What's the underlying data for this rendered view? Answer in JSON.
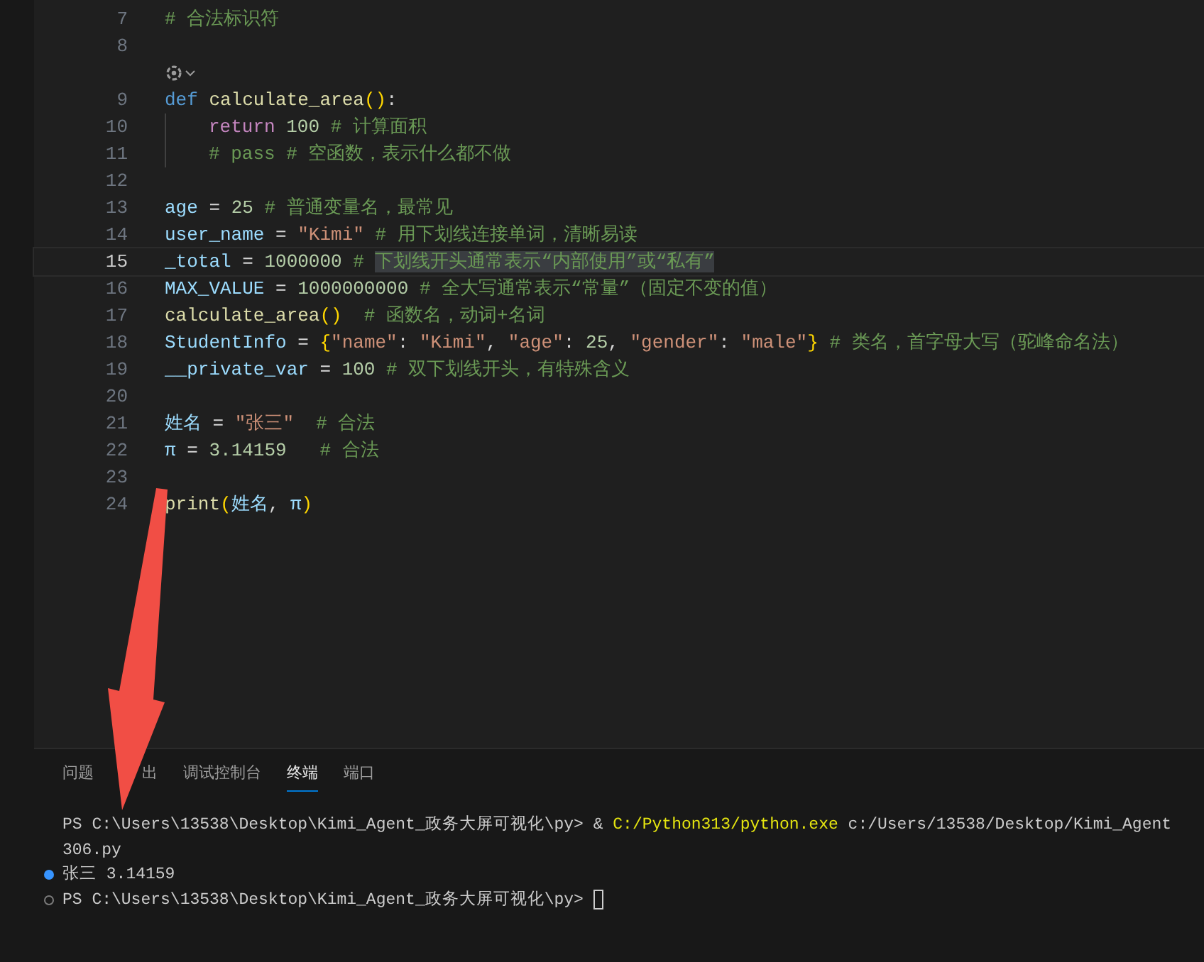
{
  "editor": {
    "lines": [
      {
        "kind": "code",
        "number": "7",
        "current": false,
        "tokens": [
          {
            "kind": "comment",
            "text": "# 合法标识符"
          }
        ]
      },
      {
        "kind": "code",
        "number": "8",
        "current": false
      },
      {
        "kind": "codelens"
      },
      {
        "kind": "code",
        "number": "9",
        "current": false,
        "tokens": [
          {
            "kind": "keyword",
            "text": "def"
          },
          {
            "kind": "function",
            "text": " calculate_area"
          },
          {
            "kind": "bracket",
            "text": "()"
          },
          {
            "kind": "plain",
            "text": ":"
          }
        ],
        "children": [
          {
            "kind": "code",
            "number": "10",
            "current": false,
            "tokens": [
              {
                "kind": "control",
                "text": "return"
              },
              {
                "kind": "number",
                "text": " 100"
              },
              {
                "kind": "comment",
                "text": " # 计算面积"
              }
            ]
          },
          {
            "kind": "code",
            "number": "11",
            "current": false,
            "tokens": [
              {
                "kind": "comment",
                "text": "# pass # 空函数，表示什么都不做"
              }
            ]
          }
        ]
      },
      {
        "kind": "code",
        "number": "12",
        "current": false
      },
      {
        "kind": "code",
        "number": "13",
        "current": false,
        "tokens": [
          {
            "kind": "variable",
            "text": "age"
          },
          {
            "kind": "plain",
            "text": " = "
          },
          {
            "kind": "number",
            "text": "25"
          },
          {
            "kind": "comment",
            "text": " # 普通变量名，最常见"
          }
        ]
      },
      {
        "kind": "code",
        "number": "14",
        "current": false,
        "tokens": [
          {
            "kind": "variable",
            "text": "user_name"
          },
          {
            "kind": "plain",
            "text": " = "
          },
          {
            "kind": "string",
            "text": "\"Kimi\""
          },
          {
            "kind": "comment",
            "text": " # 用下划线连接单词，清晰易读"
          }
        ]
      },
      {
        "kind": "code",
        "number": "15",
        "current": true,
        "tokens": [
          {
            "kind": "variable",
            "text": "_total",
            "selected": false
          },
          {
            "kind": "plain",
            "text": " = ",
            "selected": false
          },
          {
            "kind": "number",
            "text": "1000000",
            "selected": false
          },
          {
            "kind": "comment",
            "text": " # ",
            "selected": false
          },
          {
            "kind": "comment",
            "text": "下划线开头通常表示“内部使用”或“私有”",
            "selected": true
          }
        ]
      },
      {
        "kind": "code",
        "number": "16",
        "current": false,
        "tokens": [
          {
            "kind": "variable",
            "text": "MAX_VALUE"
          },
          {
            "kind": "plain",
            "text": " = "
          },
          {
            "kind": "number",
            "text": "1000000000"
          },
          {
            "kind": "comment",
            "text": " # 全大写通常表示“常量”（固定不变的值）"
          }
        ]
      },
      {
        "kind": "code",
        "number": "17",
        "current": false,
        "tokens": [
          {
            "kind": "function",
            "text": "calculate_area"
          },
          {
            "kind": "bracket",
            "text": "()"
          },
          {
            "kind": "comment",
            "text": "  # 函数名，动词+名词"
          }
        ]
      },
      {
        "kind": "code",
        "number": "18",
        "current": false,
        "tokens": [
          {
            "kind": "variable",
            "text": "StudentInfo"
          },
          {
            "kind": "plain",
            "text": " = "
          },
          {
            "kind": "bracket",
            "text": "{"
          },
          {
            "kind": "string",
            "text": "\"name\""
          },
          {
            "kind": "plain",
            "text": ": "
          },
          {
            "kind": "string",
            "text": "\"Kimi\""
          },
          {
            "kind": "plain",
            "text": ", "
          },
          {
            "kind": "string",
            "text": "\"age\""
          },
          {
            "kind": "plain",
            "text": ": "
          },
          {
            "kind": "number",
            "text": "25"
          },
          {
            "kind": "plain",
            "text": ", "
          },
          {
            "kind": "string",
            "text": "\"gender\""
          },
          {
            "kind": "plain",
            "text": ": "
          },
          {
            "kind": "string",
            "text": "\"male\""
          },
          {
            "kind": "bracket",
            "text": "}"
          },
          {
            "kind": "comment",
            "text": " # 类名，首字母大写（驼峰命名法）"
          }
        ]
      },
      {
        "kind": "code",
        "number": "19",
        "current": false,
        "tokens": [
          {
            "kind": "variable",
            "text": "__private_var"
          },
          {
            "kind": "plain",
            "text": " = "
          },
          {
            "kind": "number",
            "text": "100"
          },
          {
            "kind": "comment",
            "text": " # 双下划线开头，有特殊含义"
          }
        ]
      },
      {
        "kind": "code",
        "number": "20",
        "current": false
      },
      {
        "kind": "code",
        "number": "21",
        "current": false,
        "tokens": [
          {
            "kind": "variable",
            "text": "姓名"
          },
          {
            "kind": "plain",
            "text": " = "
          },
          {
            "kind": "string",
            "text": "\"张三\""
          },
          {
            "kind": "comment",
            "text": "  # 合法"
          }
        ]
      },
      {
        "kind": "code",
        "number": "22",
        "current": false,
        "tokens": [
          {
            "kind": "variable",
            "text": "π"
          },
          {
            "kind": "plain",
            "text": " = "
          },
          {
            "kind": "number",
            "text": "3.14159"
          },
          {
            "kind": "comment",
            "text": "   # 合法"
          }
        ]
      },
      {
        "kind": "code",
        "number": "23",
        "current": false
      },
      {
        "kind": "code",
        "number": "24",
        "current": false,
        "tokens": [
          {
            "kind": "function",
            "text": "print"
          },
          {
            "kind": "bracket",
            "text": "("
          },
          {
            "kind": "variable",
            "text": "姓名"
          },
          {
            "kind": "plain",
            "text": ", "
          },
          {
            "kind": "variable",
            "text": "π"
          },
          {
            "kind": "bracket",
            "text": ")"
          }
        ]
      }
    ]
  },
  "panel": {
    "tabs": [
      {
        "label": "问题",
        "selected": false
      },
      {
        "label": "出",
        "selected": false
      },
      {
        "label": "调试控制台",
        "selected": false
      },
      {
        "label": "终端",
        "selected": true
      },
      {
        "label": "端口",
        "selected": false
      }
    ],
    "terminal": [
      {
        "kind": "plain",
        "cursor": false,
        "tokens": [
          {
            "kind": "plain",
            "text": "PS C:\\Users\\13538\\Desktop\\Kimi_Agent_政务大屏可视化\\py> & "
          },
          {
            "kind": "command",
            "text": "C:/Python313/python.exe"
          },
          {
            "kind": "plain",
            "text": " c:/Users/13538/Desktop/Kimi_Agent"
          }
        ]
      },
      {
        "kind": "plain",
        "cursor": false,
        "tokens": [
          {
            "kind": "plain",
            "text": "306.py"
          }
        ]
      },
      {
        "kind": "success",
        "cursor": false,
        "tokens": [
          {
            "kind": "plain",
            "text": "张三 3.14159"
          }
        ]
      },
      {
        "kind": "idle",
        "cursor": true,
        "tokens": [
          {
            "kind": "plain",
            "text": "PS C:\\Users\\13538\\Desktop\\Kimi_Agent_政务大屏可视化\\py> "
          }
        ]
      }
    ]
  }
}
